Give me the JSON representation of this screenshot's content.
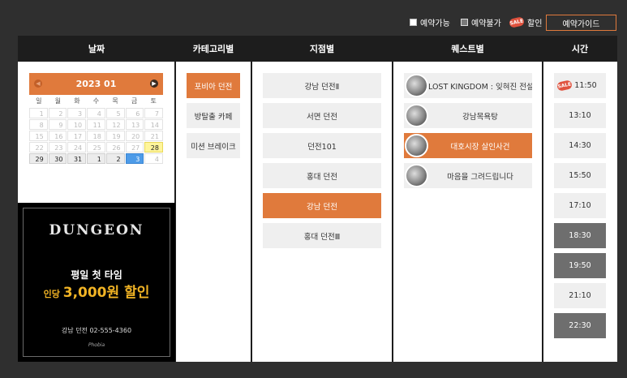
{
  "legend": {
    "available": "예약가능",
    "unavailable": "예약불가",
    "sale_icon": "SALE",
    "discount": "할인",
    "guide_button": "예약가이드"
  },
  "headers": {
    "date": "날짜",
    "category": "카테고리별",
    "branch": "지점별",
    "theme": "퀘스트별",
    "time": "시간"
  },
  "calendar": {
    "title": "2023 01",
    "prev_icon": "chevron-left-icon",
    "next_icon": "chevron-right-icon",
    "weekdays": [
      "일",
      "월",
      "화",
      "수",
      "목",
      "금",
      "토"
    ],
    "days": [
      {
        "d": "1",
        "s": "past"
      },
      {
        "d": "2",
        "s": "past"
      },
      {
        "d": "3",
        "s": "past"
      },
      {
        "d": "4",
        "s": "past"
      },
      {
        "d": "5",
        "s": "past"
      },
      {
        "d": "6",
        "s": "past"
      },
      {
        "d": "7",
        "s": "past"
      },
      {
        "d": "8",
        "s": "past"
      },
      {
        "d": "9",
        "s": "past"
      },
      {
        "d": "10",
        "s": "past"
      },
      {
        "d": "11",
        "s": "past"
      },
      {
        "d": "12",
        "s": "past"
      },
      {
        "d": "13",
        "s": "past"
      },
      {
        "d": "14",
        "s": "past"
      },
      {
        "d": "15",
        "s": "past"
      },
      {
        "d": "16",
        "s": "past"
      },
      {
        "d": "17",
        "s": "past"
      },
      {
        "d": "18",
        "s": "past"
      },
      {
        "d": "19",
        "s": "past"
      },
      {
        "d": "20",
        "s": "past"
      },
      {
        "d": "21",
        "s": "past"
      },
      {
        "d": "22",
        "s": "past"
      },
      {
        "d": "23",
        "s": "past"
      },
      {
        "d": "24",
        "s": "past"
      },
      {
        "d": "25",
        "s": "past"
      },
      {
        "d": "26",
        "s": "past"
      },
      {
        "d": "27",
        "s": "past"
      },
      {
        "d": "28",
        "s": "today"
      },
      {
        "d": "29",
        "s": "active"
      },
      {
        "d": "30",
        "s": "active"
      },
      {
        "d": "31",
        "s": "active"
      },
      {
        "d": "1",
        "s": "active"
      },
      {
        "d": "2",
        "s": "active"
      },
      {
        "d": "3",
        "s": "selected"
      },
      {
        "d": "4",
        "s": "past"
      }
    ]
  },
  "banner": {
    "logo": "DUNGEON",
    "line1": "평일 첫 타임",
    "line2_prefix": "인당",
    "line2_amount": "3,000원 할인",
    "contact": "강남 던전 02-555-4360",
    "brand": "Phobia"
  },
  "categories": [
    {
      "label": "포비아 던전",
      "active": true
    },
    {
      "label": "방탈출 카페",
      "active": false
    },
    {
      "label": "미션 브레이크",
      "active": false
    }
  ],
  "branches": [
    {
      "label": "강남 던전Ⅱ",
      "active": false
    },
    {
      "label": "서면 던전",
      "active": false
    },
    {
      "label": "던전101",
      "active": false
    },
    {
      "label": "홍대 던전",
      "active": false
    },
    {
      "label": "강남 던전",
      "active": true
    },
    {
      "label": "홍대 던전Ⅲ",
      "active": false
    }
  ],
  "themes": [
    {
      "label": "LOST KINGDOM : 잊혀진 전설",
      "active": false
    },
    {
      "label": "강남목욕탕",
      "active": false
    },
    {
      "label": "대호시장 살인사건",
      "active": true
    },
    {
      "label": "마음을 그려드립니다",
      "active": false
    }
  ],
  "times": [
    {
      "label": "11:50",
      "state": "available",
      "sale": true
    },
    {
      "label": "13:10",
      "state": "available",
      "sale": false
    },
    {
      "label": "14:30",
      "state": "available",
      "sale": false
    },
    {
      "label": "15:50",
      "state": "available",
      "sale": false
    },
    {
      "label": "17:10",
      "state": "available",
      "sale": false
    },
    {
      "label": "18:30",
      "state": "unavailable",
      "sale": false
    },
    {
      "label": "19:50",
      "state": "unavailable",
      "sale": false
    },
    {
      "label": "21:10",
      "state": "available",
      "sale": false
    },
    {
      "label": "22:30",
      "state": "unavailable",
      "sale": false
    }
  ],
  "colors": {
    "accent": "#e07a3c",
    "header_bg": "#1d1d1d",
    "page_bg": "#2f2f2f",
    "unavailable": "#6e6e6e",
    "selected_day": "#4d9be8",
    "today": "#fff59a",
    "banner_highlight": "#f2b425"
  }
}
